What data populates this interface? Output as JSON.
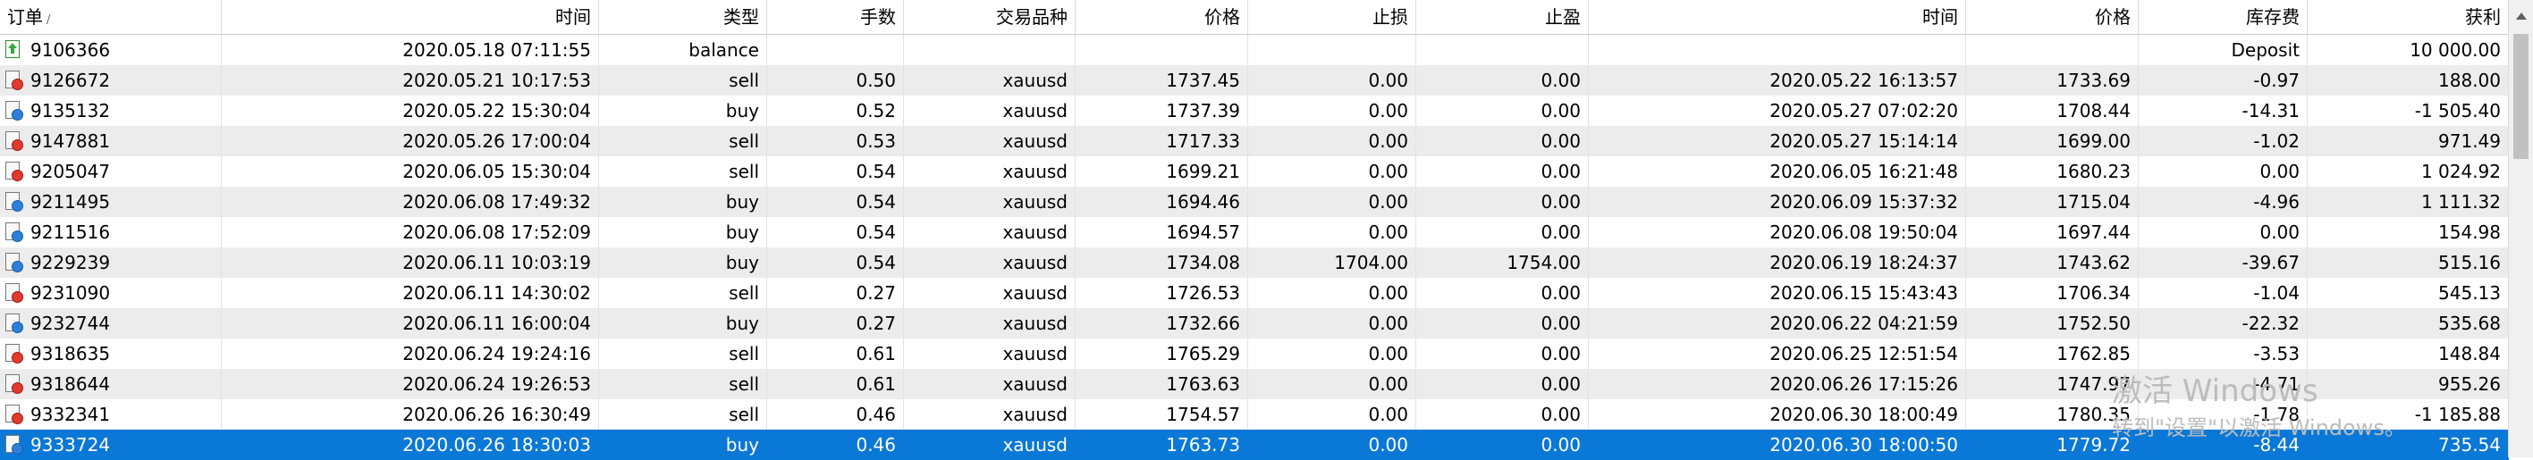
{
  "columns": [
    "订单",
    "时间",
    "类型",
    "手数",
    "交易品种",
    "价格",
    "止损",
    "止盈",
    "时间",
    "价格",
    "库存费",
    "获利"
  ],
  "sort_indicator": "/",
  "rows": [
    {
      "kind": "bal",
      "cells": [
        "9106366",
        "2020.05.18 07:11:55",
        "balance",
        "",
        "",
        "",
        "",
        "",
        "",
        "",
        "Deposit",
        "10 000.00"
      ]
    },
    {
      "kind": "sell",
      "cells": [
        "9126672",
        "2020.05.21 10:17:53",
        "sell",
        "0.50",
        "xauusd",
        "1737.45",
        "0.00",
        "0.00",
        "2020.05.22 16:13:57",
        "1733.69",
        "-0.97",
        "188.00"
      ]
    },
    {
      "kind": "buy",
      "cells": [
        "9135132",
        "2020.05.22 15:30:04",
        "buy",
        "0.52",
        "xauusd",
        "1737.39",
        "0.00",
        "0.00",
        "2020.05.27 07:02:20",
        "1708.44",
        "-14.31",
        "-1 505.40"
      ]
    },
    {
      "kind": "sell",
      "cells": [
        "9147881",
        "2020.05.26 17:00:04",
        "sell",
        "0.53",
        "xauusd",
        "1717.33",
        "0.00",
        "0.00",
        "2020.05.27 15:14:14",
        "1699.00",
        "-1.02",
        "971.49"
      ]
    },
    {
      "kind": "sell",
      "cells": [
        "9205047",
        "2020.06.05 15:30:04",
        "sell",
        "0.54",
        "xauusd",
        "1699.21",
        "0.00",
        "0.00",
        "2020.06.05 16:21:48",
        "1680.23",
        "0.00",
        "1 024.92"
      ]
    },
    {
      "kind": "buy",
      "cells": [
        "9211495",
        "2020.06.08 17:49:32",
        "buy",
        "0.54",
        "xauusd",
        "1694.46",
        "0.00",
        "0.00",
        "2020.06.09 15:37:32",
        "1715.04",
        "-4.96",
        "1 111.32"
      ]
    },
    {
      "kind": "buy",
      "cells": [
        "9211516",
        "2020.06.08 17:52:09",
        "buy",
        "0.54",
        "xauusd",
        "1694.57",
        "0.00",
        "0.00",
        "2020.06.08 19:50:04",
        "1697.44",
        "0.00",
        "154.98"
      ]
    },
    {
      "kind": "buy",
      "cells": [
        "9229239",
        "2020.06.11 10:03:19",
        "buy",
        "0.54",
        "xauusd",
        "1734.08",
        "1704.00",
        "1754.00",
        "2020.06.19 18:24:37",
        "1743.62",
        "-39.67",
        "515.16"
      ]
    },
    {
      "kind": "sell",
      "cells": [
        "9231090",
        "2020.06.11 14:30:02",
        "sell",
        "0.27",
        "xauusd",
        "1726.53",
        "0.00",
        "0.00",
        "2020.06.15 15:43:43",
        "1706.34",
        "-1.04",
        "545.13"
      ]
    },
    {
      "kind": "buy",
      "cells": [
        "9232744",
        "2020.06.11 16:00:04",
        "buy",
        "0.27",
        "xauusd",
        "1732.66",
        "0.00",
        "0.00",
        "2020.06.22 04:21:59",
        "1752.50",
        "-22.32",
        "535.68"
      ]
    },
    {
      "kind": "sell",
      "cells": [
        "9318635",
        "2020.06.24 19:24:16",
        "sell",
        "0.61",
        "xauusd",
        "1765.29",
        "0.00",
        "0.00",
        "2020.06.25 12:51:54",
        "1762.85",
        "-3.53",
        "148.84"
      ]
    },
    {
      "kind": "sell",
      "cells": [
        "9318644",
        "2020.06.24 19:26:53",
        "sell",
        "0.61",
        "xauusd",
        "1763.63",
        "0.00",
        "0.00",
        "2020.06.26 17:15:26",
        "1747.97",
        "-4.71",
        "955.26"
      ]
    },
    {
      "kind": "sell",
      "cells": [
        "9332341",
        "2020.06.26 16:30:49",
        "sell",
        "0.46",
        "xauusd",
        "1754.57",
        "0.00",
        "0.00",
        "2020.06.30 18:00:49",
        "1780.35",
        "-1.78",
        "-1 185.88"
      ]
    },
    {
      "kind": "buy",
      "selected": true,
      "cells": [
        "9333724",
        "2020.06.26 18:30:03",
        "buy",
        "0.46",
        "xauusd",
        "1763.73",
        "0.00",
        "0.00",
        "2020.06.30 18:00:50",
        "1779.72",
        "-8.44",
        "735.54"
      ]
    }
  ],
  "watermark": {
    "line1": "激活 Windows",
    "line2": "转到\"设置\"以激活 Windows。"
  }
}
